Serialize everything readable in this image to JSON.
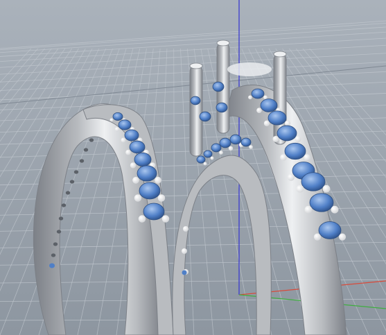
{
  "viewport": {
    "background_top": "#aab2bb",
    "background_bottom": "#8d96a0",
    "grid_color": "#c2c8cf",
    "grid_dark": "#7f8893",
    "axis_colors": {
      "x": "#d94a3a",
      "y": "#3fae3f",
      "z": "#3b3bd0"
    }
  },
  "model": {
    "metal_color": "#b9bcc0",
    "metal_highlight": "#eef0f2",
    "metal_shadow": "#7c8087",
    "gem_color": "#4f7fc7",
    "gem_highlight": "#a9c6ef",
    "prong_color": "#d2d4d7"
  },
  "icons": [
    "axis-x",
    "axis-y",
    "axis-z"
  ]
}
